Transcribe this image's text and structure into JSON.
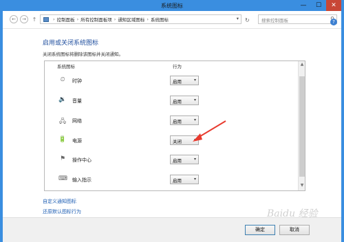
{
  "window": {
    "title": "系统图标"
  },
  "nav": {
    "back": "←",
    "forward": "→",
    "up": "↑",
    "breadcrumbs": [
      "控制面板",
      "所有控制面板项",
      "通知区域图标",
      "系统图标"
    ],
    "search_placeholder": "搜索控制面板",
    "refresh": "↻"
  },
  "heading": "启用或关闭系统图标",
  "subtitle": "关闭系统图标将删除该图标并关闭通知。",
  "table": {
    "columns": [
      "系统图标",
      "行为"
    ],
    "rows": [
      {
        "icon": "clock-icon",
        "glyph": "⏲",
        "name": "时钟",
        "value": "启用"
      },
      {
        "icon": "volume-icon",
        "glyph": "🔉",
        "name": "音量",
        "value": "启用"
      },
      {
        "icon": "network-icon",
        "glyph": "🖧",
        "name": "网络",
        "value": "启用"
      },
      {
        "icon": "power-icon",
        "glyph": "🔋",
        "name": "电源",
        "value": "关闭"
      },
      {
        "icon": "action-center-icon",
        "glyph": "⚑",
        "name": "操作中心",
        "value": "启用"
      },
      {
        "icon": "input-indicator-icon",
        "glyph": "⌨",
        "name": "输入指示",
        "value": "启用"
      }
    ]
  },
  "links": {
    "customize": "自定义通知图标",
    "restore": "还原默认图标行为"
  },
  "buttons": {
    "ok": "确定",
    "cancel": "取消"
  },
  "watermark": "Baidu 经验",
  "colors": {
    "accent": "#3a8ee0",
    "close": "#c84736",
    "link": "#1c5db3",
    "annotation_arrow": "#e83a2e"
  }
}
